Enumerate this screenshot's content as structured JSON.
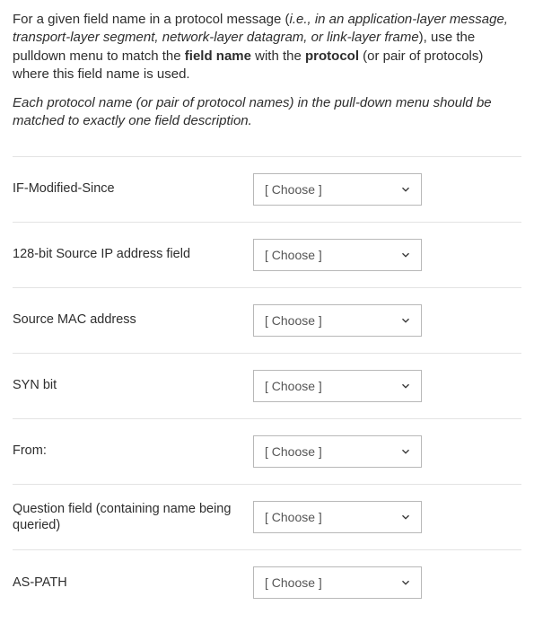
{
  "intro": {
    "pre": "For a given field name in a protocol message (",
    "italic": "i.e., in an application-layer message, transport-layer segment, network-layer datagram, or link-layer frame",
    "mid1": "), use the pulldown menu to match the ",
    "bold1": "field name",
    "mid2": " with the ",
    "bold2": "protocol",
    "post": " (or pair of protocols) where this field name is used."
  },
  "note": "Each protocol name (or pair of protocol names) in the pull-down menu should be matched to exactly one field description.",
  "choose_label": "[ Choose ]",
  "rows": [
    {
      "label": "IF-Modified-Since"
    },
    {
      "label": "128-bit Source IP address field"
    },
    {
      "label": "Source MAC address"
    },
    {
      "label": "SYN bit"
    },
    {
      "label": "From:"
    },
    {
      "label": "Question field (containing name being queried)"
    },
    {
      "label": "AS-PATH"
    }
  ]
}
